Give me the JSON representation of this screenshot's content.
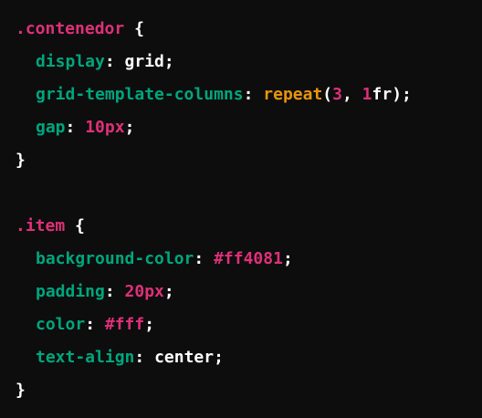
{
  "code": {
    "rule1": {
      "selector": ".contenedor",
      "open_brace": "{",
      "close_brace": "}",
      "decl1": {
        "prop": "display",
        "value": "grid"
      },
      "decl2": {
        "prop": "grid-template-columns",
        "func": "repeat",
        "arg1": "3",
        "arg2_num": "1",
        "arg2_unit": "fr"
      },
      "decl3": {
        "prop": "gap",
        "value": "10px"
      }
    },
    "rule2": {
      "selector": ".item",
      "open_brace": "{",
      "close_brace": "}",
      "decl1": {
        "prop": "background-color",
        "value": "#ff4081"
      },
      "decl2": {
        "prop": "padding",
        "value": "20px"
      },
      "decl3": {
        "prop": "color",
        "value": "#fff"
      },
      "decl4": {
        "prop": "text-align",
        "value": "center"
      }
    }
  },
  "colors": {
    "background": "#0d0d0d",
    "selector": "#df3079",
    "property": "#00a67d",
    "function": "#e9950c",
    "number": "#df3079",
    "text": "#ffffff"
  }
}
